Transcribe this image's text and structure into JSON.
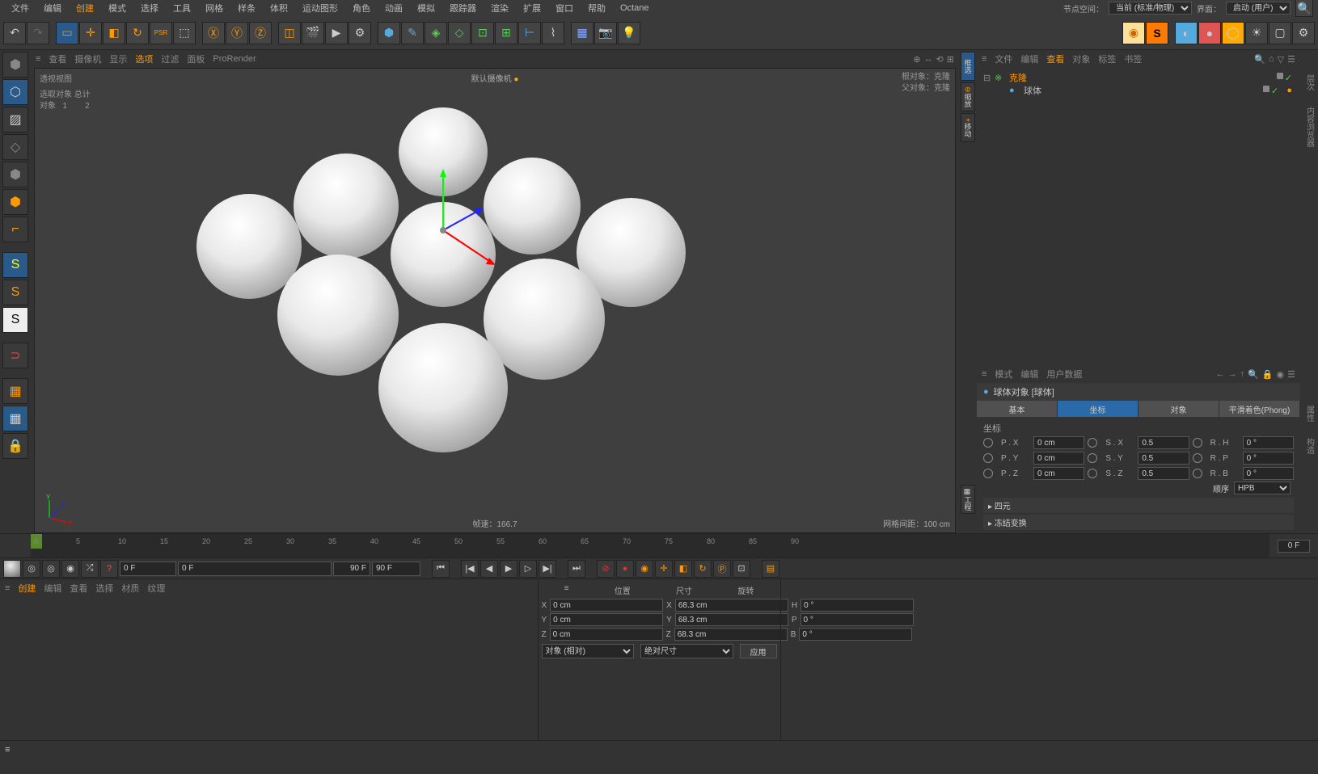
{
  "menu": {
    "items": [
      "文件",
      "编辑",
      "创建",
      "模式",
      "选择",
      "工具",
      "网格",
      "样条",
      "体积",
      "运动图形",
      "角色",
      "动画",
      "模拟",
      "跟踪器",
      "渲染",
      "扩展",
      "窗口",
      "帮助",
      "Octane"
    ]
  },
  "menubar_right": {
    "nodespace_lbl": "节点空间：",
    "nodespace_val": "当前 (标准/物理)",
    "layout_lbl": "界面：",
    "layout_val": "启动 (用户)"
  },
  "vp": {
    "tabs": [
      "查看",
      "摄像机",
      "显示",
      "选项",
      "过滤",
      "面板",
      "ProRender"
    ],
    "label": "透视视图",
    "camera": "默认摄像机",
    "root": "根对象：克隆",
    "parent": "父对象：克隆",
    "sel_title": "选取对象 总计",
    "sel_obj": "对象",
    "sel_1": "1",
    "sel_2": "2",
    "fps": "帧速：166.7",
    "grid": "网格间距：100 cm"
  },
  "right_nav": {
    "items": [
      "框选",
      "缩放",
      "移动"
    ],
    "proj": "工程"
  },
  "objpanel": {
    "tabs": [
      "文件",
      "编辑",
      "查看",
      "对象",
      "标签",
      "书签"
    ],
    "obj1": "克隆",
    "obj2": "球体"
  },
  "attr": {
    "tabs": [
      "模式",
      "编辑",
      "用户数据"
    ],
    "title": "球体对象 [球体]",
    "subtabs": [
      "基本",
      "坐标",
      "对象",
      "平滑着色(Phong)"
    ],
    "sec": "坐标",
    "px": "P . X",
    "py": "P . Y",
    "pz": "P . Z",
    "sx": "S . X",
    "sy": "S . Y",
    "sz": "S . Z",
    "rh": "R . H",
    "rp": "R . P",
    "rb": "R . B",
    "v0": "0 cm",
    "v05": "0.5",
    "vd": "0 °",
    "order": "顺序",
    "hpb": "HPB",
    "quat": "四元",
    "freeze": "冻结变换"
  },
  "timeline": {
    "ticks": [
      "0",
      "5",
      "10",
      "15",
      "20",
      "25",
      "30",
      "35",
      "40",
      "45",
      "50",
      "55",
      "60",
      "65",
      "70",
      "75",
      "80",
      "85",
      "90"
    ],
    "end": "0 F",
    "f0": "0 F",
    "f1": "0 F",
    "f2": "90 F",
    "f3": "90 F"
  },
  "mat": {
    "tabs": [
      "创建",
      "编辑",
      "查看",
      "选择",
      "材质",
      "纹理"
    ]
  },
  "coord": {
    "pos": "位置",
    "size": "尺寸",
    "rot": "旋转",
    "x": "X",
    "y": "Y",
    "z": "Z",
    "v0": "0 cm",
    "v683": "68.3 cm",
    "h": "H",
    "p": "P",
    "b": "B",
    "vd": "0 °",
    "objrel": "对象 (相对)",
    "abssize": "绝对尺寸",
    "apply": "应用"
  },
  "far": {
    "tabs": [
      "层次",
      "内容浏览器",
      "属性",
      "构造"
    ]
  }
}
